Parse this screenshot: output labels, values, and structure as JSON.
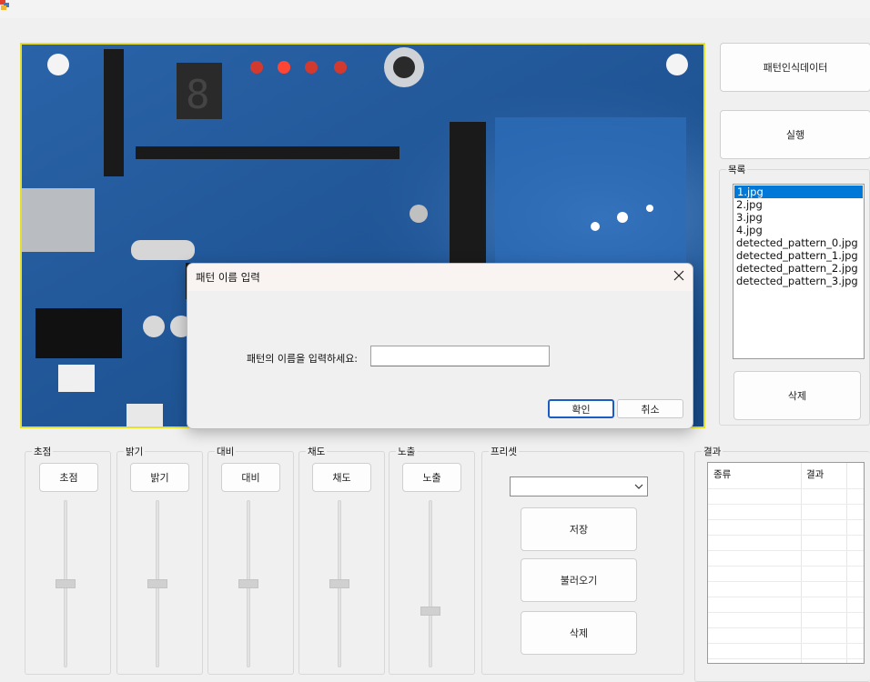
{
  "app": {
    "icon": "app-icon"
  },
  "dialog": {
    "title": "패턴 이름 입력",
    "prompt": "패턴의 이름을 입력하세요:",
    "input_value": "",
    "ok_label": "확인",
    "cancel_label": "취소",
    "close_icon": "close-icon"
  },
  "side": {
    "pattern_data_button": "패턴인식데이터",
    "run_button": "실행",
    "list_group_label": "목록",
    "list_items": [
      "1.jpg",
      "2.jpg",
      "3.jpg",
      "4.jpg",
      "detected_pattern_0.jpg",
      "detected_pattern_1.jpg",
      "detected_pattern_2.jpg",
      "detected_pattern_3.jpg"
    ],
    "selected_index": 0,
    "delete_button": "삭제"
  },
  "controls": [
    {
      "group_label": "초점",
      "button": "초점",
      "slider_value": 0.5
    },
    {
      "group_label": "밝기",
      "button": "밝기",
      "slider_value": 0.5
    },
    {
      "group_label": "대비",
      "button": "대비",
      "slider_value": 0.5
    },
    {
      "group_label": "채도",
      "button": "채도",
      "slider_value": 0.5
    },
    {
      "group_label": "노출",
      "button": "노출",
      "slider_value": 0.33
    }
  ],
  "preset": {
    "group_label": "프리셋",
    "combo_value": "",
    "save_button": "저장",
    "load_button": "불러오기",
    "delete_button": "삭제"
  },
  "result": {
    "group_label": "결과",
    "columns": [
      "종류",
      "결과"
    ],
    "rows": []
  },
  "colors": {
    "accent": "#0078d7",
    "camera_border": "#e6e02a",
    "default_button_border": "#1a5cc4"
  }
}
